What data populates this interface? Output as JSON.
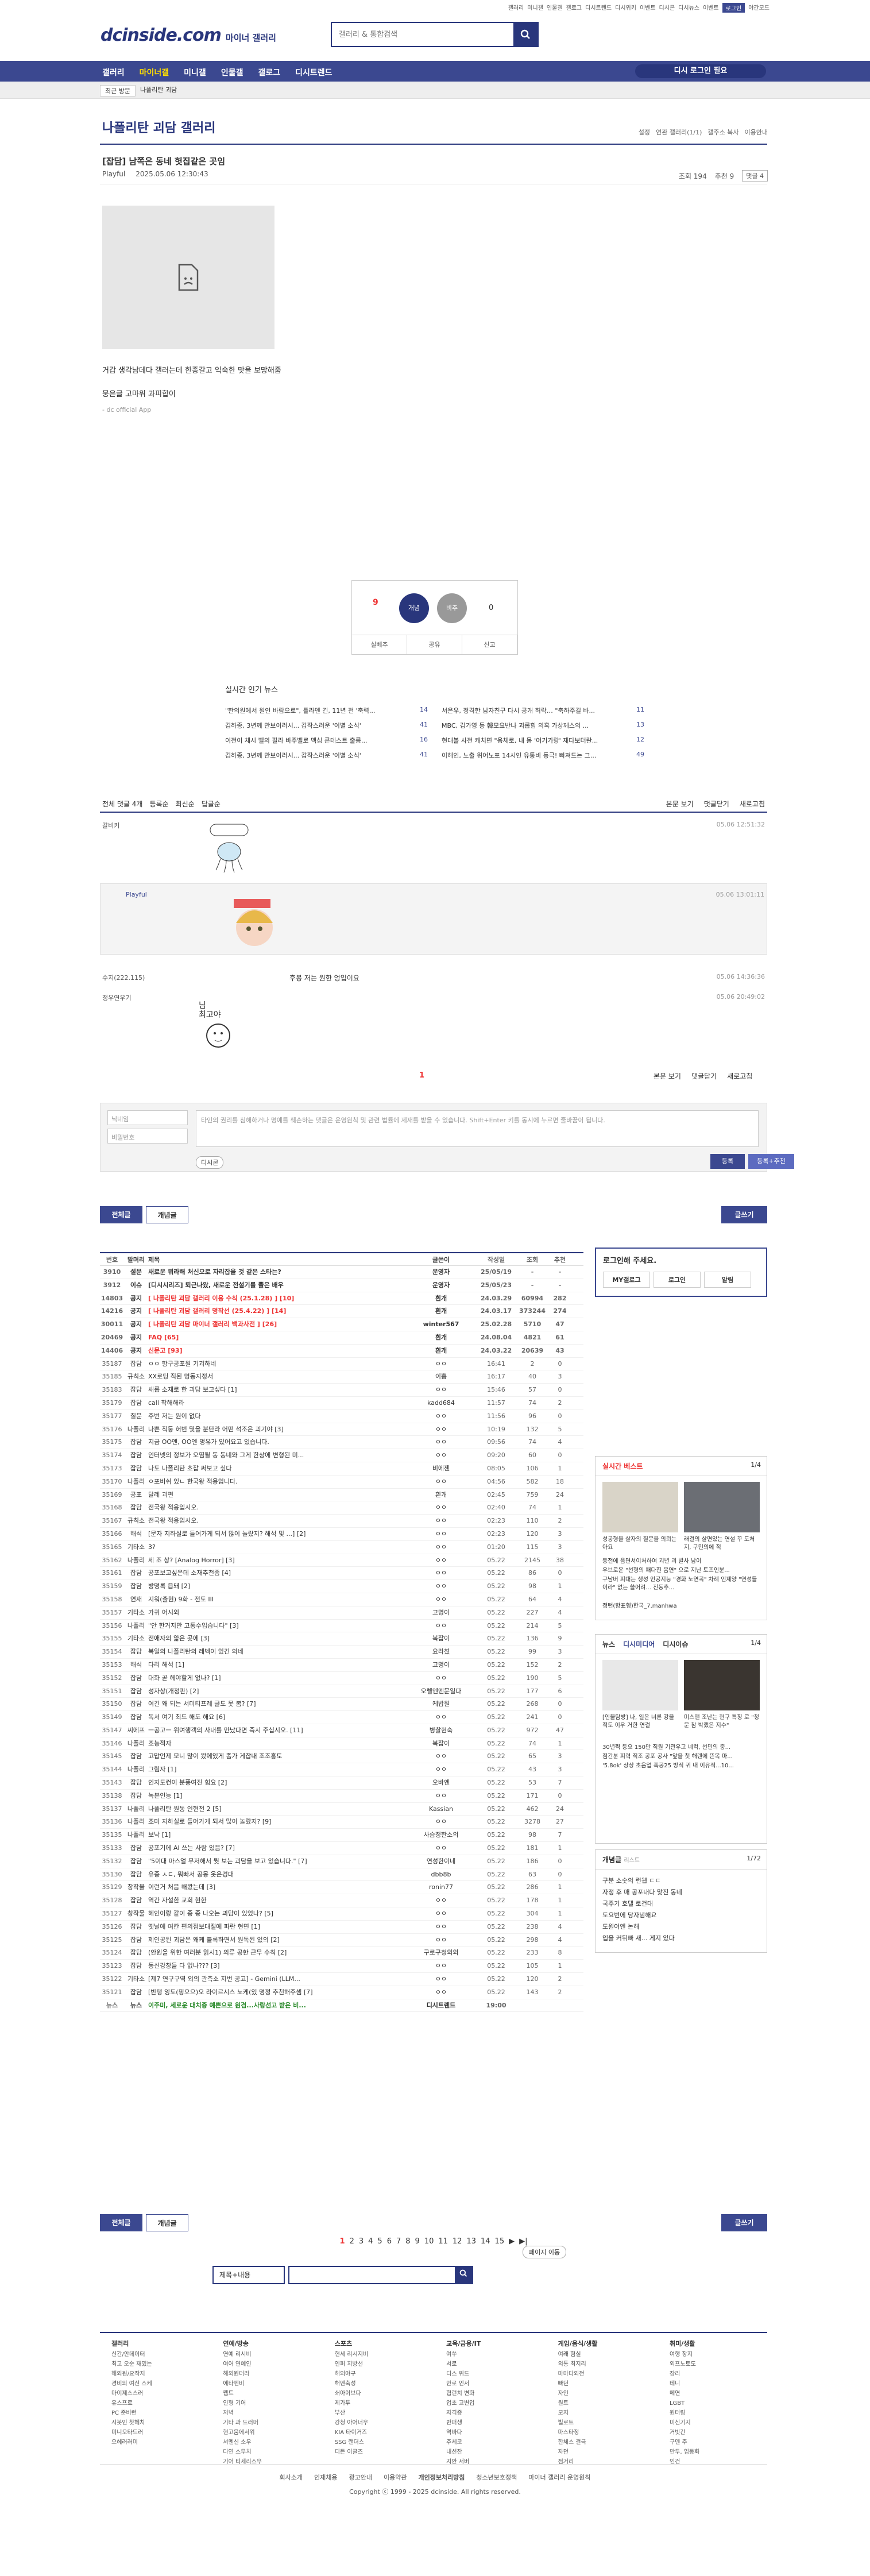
{
  "topbar": {
    "links": [
      "갤러리",
      "미니갤",
      "인물갤",
      "갤로그",
      "디시트렌드",
      "디시위키",
      "이벤트",
      "디시콘",
      "디시뉴스",
      "이벤트",
      "로그인",
      "야간모드"
    ]
  },
  "logo": {
    "brand": "dcinside.com",
    "sub": "마이너 갤러리"
  },
  "search": {
    "placeholder": "갤러리 & 통합검색"
  },
  "gnb": {
    "items": [
      "갤러리",
      "마이너갤",
      "미니갤",
      "인물갤",
      "갤로그",
      "디시트렌드"
    ],
    "active": 1,
    "right": "디시 로그인 필요"
  },
  "subbar": {
    "recent": "최근 방문",
    "recent_item": "나폴리탄 괴담"
  },
  "gallery": {
    "title": "나폴리탄 괴담 갤러리",
    "opts": [
      "설정",
      "연관 갤러리(1/1)",
      "갤주소 복사",
      "이용안내"
    ]
  },
  "post": {
    "title": "[잡담] 남쪽은 동네 헛집같은 곳임",
    "author": "Playful",
    "date": "2025.05.06 12:30:43",
    "views": "조회 194",
    "rec": "추천 9",
    "comments": "댓글 4",
    "body": [
      "거갑 생각남데다 갤러는데 한종갈고 익숙한 맛을 보망해줌",
      "뭉은글 고마워 과피합이",
      "- dc official App"
    ]
  },
  "recommend": {
    "up": "9",
    "up_sub": "고정 0",
    "up_btn": "개념",
    "down_btn": "비추",
    "down": "0",
    "actions": [
      "실베추",
      "공유",
      "신고"
    ]
  },
  "news": {
    "title": "실시간 인기 뉴스",
    "items": [
      {
        "t": "\"한의원에서 원인 바람으로\", 틀라덴 긴, 11년 전 '축력...",
        "c": "14"
      },
      {
        "t": "서은우, 정격한 남자친구 다시 공개 허락… \"축하주길 바...",
        "c": "11"
      },
      {
        "t": "김하종, 3년께 만보이러시... 갑작스러운 '이별 소식'",
        "c": "41"
      },
      {
        "t": "MBC, 김가영 등 韓모요반나 괴롭힘 의혹 가상께스의 ...",
        "c": "13"
      },
      {
        "t": "이전이 체시 벨의 펄라 바주벨로 맥심 콘테스트 출름...",
        "c": "16"
      },
      {
        "t": "현대볼 사전 캐치면 \"음체로, 내 몸 '어기가랑' 재다보더란...",
        "c": "12"
      },
      {
        "t": "김하종, 3년께 만보이러시... 갑작스러운 '이별 소식'",
        "c": "41"
      },
      {
        "t": "이해인, 노출 위어노포 14시인 유통비 등극! 빠져드는 그...",
        "c": "49"
      }
    ]
  },
  "comments": {
    "sort": [
      "전체 댓글 4개",
      "등록순",
      "최신순",
      "답글순"
    ],
    "right": [
      "본문 보기",
      "댓글닫기",
      "새로고침"
    ],
    "items": [
      {
        "nick": "갈비키",
        "date": "05.06 12:51:32",
        "txt": "(디시콘) 포인트해주요"
      },
      {
        "nick": "Playful",
        "date": "05.06 13:01:11",
        "txt": "(디시콘) 끄덕끄덕"
      },
      {
        "nick": "수지(222.115)",
        "date": "05.06 14:36:36",
        "txt": "후봉 저는 원한 엉입이요"
      },
      {
        "nick": "정우연우기",
        "date": "05.06 20:49:02",
        "txt": "(디시콘) 고야"
      }
    ],
    "page": "1",
    "nick_ph": "닉네임",
    "pw_ph": "비밀번호",
    "ta_ph": "타인의 권리를 침해하거나 명예를 훼손하는 댓글은 운영원칙 및 관련 법률에 제재를 받을 수 있습니다. Shift+Enter 키를 동시에 누르면 줄바꿈이 됩니다.",
    "dccon": "디시콘",
    "submit": "등록",
    "submit2": "등록+추천"
  },
  "tabs": {
    "all": "전체글",
    "best": "개념글",
    "write": "글쓰기"
  },
  "list": {
    "headers": [
      "번호",
      "말머리",
      "제목",
      "글쓴이",
      "작성일",
      "조회",
      "추천"
    ],
    "rows": [
      [
        "3910",
        "설문",
        "새로운 뭐라해 처신으로 자리잡을 것 같은 스타는?",
        "운영자",
        "25/05/19",
        "-",
        "-"
      ],
      [
        "3912",
        "이슈",
        "[디시시리즈] 퇴근나왔, 새로운 전설기를 뿔은 배우",
        "운영자",
        "25/05/23",
        "-",
        "-"
      ],
      [
        "14803",
        "공지",
        "[ 나폴리탄 괴담 갤러리 이용 수칙 (25.1.28) ] [10]",
        "흰개",
        "24.03.29",
        "60994",
        "282"
      ],
      [
        "14216",
        "공지",
        "[ 나폴리탄 괴담 갤러리 명작선 (25.4.22) ] [14]",
        "흰개",
        "24.03.17",
        "373244",
        "274"
      ],
      [
        "30011",
        "공지",
        "[ 나폴리탄 괴담 마이너 갤러리 백과사전 ] [26]",
        "winter567",
        "25.02.28",
        "5710",
        "47"
      ],
      [
        "20469",
        "공지",
        "FAQ [65]",
        "흰개",
        "24.08.04",
        "4821",
        "61"
      ],
      [
        "14406",
        "공지",
        "신문고 [93]",
        "흰개",
        "24.03.22",
        "20639",
        "43"
      ],
      [
        "35187",
        "잡담",
        "ㅇㅇ 항구공포원 기괴하네",
        "ㅇㅇ",
        "16:41",
        "2",
        "0"
      ],
      [
        "35185",
        "규칙소",
        "XX로딩 직된 명동지정서",
        "이쁨",
        "16:17",
        "40",
        "3"
      ],
      [
        "35183",
        "잡담",
        "새롭 소재로 한 괴담 보고싶다 [1]",
        "ㅇㅇ",
        "15:46",
        "57",
        "0"
      ],
      [
        "35179",
        "잡담",
        "call 착해해라",
        "kadd684",
        "11:57",
        "74",
        "2"
      ],
      [
        "35177",
        "질문",
        "주번 저는 원이 없다",
        "ㅇㅇ",
        "11:56",
        "96",
        "0"
      ],
      [
        "35176",
        "나폴리",
        "나쁜 직둥 허번 몇을 분단라 어떤 석조은 괴기야 [3]",
        "ㅇㅇ",
        "10:19",
        "132",
        "5"
      ],
      [
        "35175",
        "잡담",
        "지금 OO엔, OO엔 명유가 있어요고 있습니다.",
        "ㅇㅇ",
        "09:56",
        "74",
        "4"
      ],
      [
        "35174",
        "잡담",
        "인터넷의 정보가 오염될 동 동네와 그게 한상에 변형된 미...",
        "ㅇㅇ",
        "09:20",
        "60",
        "0"
      ],
      [
        "35173",
        "잡담",
        "나도 나폴리탄 초잡 써보고 싶다",
        "비에젠",
        "08:05",
        "106",
        "1"
      ],
      [
        "35170",
        "나폴리",
        "ㅇ포비쉬 있ㄴ 한국왕 적용입니다.",
        "ㅇㅇ",
        "04:56",
        "582",
        "18"
      ],
      [
        "35169",
        "공포",
        "달레 괴편",
        "흰개",
        "02:45",
        "759",
        "24"
      ],
      [
        "35168",
        "잡담",
        "전국왕 적응입시오.",
        "ㅇㅇ",
        "02:40",
        "74",
        "1"
      ],
      [
        "35167",
        "규칙소",
        "전국왕 적응입시오.",
        "ㅇㅇ",
        "02:23",
        "110",
        "2"
      ],
      [
        "35166",
        "해석",
        "[문자 지하실로 들어가게 되서 많이 놀랐지? 해석 및 ...] [2]",
        "ㅇㅇ",
        "02:23",
        "120",
        "3"
      ],
      [
        "35165",
        "기타소",
        "3?",
        "ㅇㅇ",
        "01:20",
        "115",
        "3"
      ],
      [
        "35162",
        "나폴리",
        "세 조 상? [Analog Horror] [3]",
        "ㅇㅇ",
        "05.22",
        "2145",
        "38"
      ],
      [
        "35161",
        "잡담",
        "공포보고싶은데 소재추천좀 [4]",
        "ㅇㅇ",
        "05.22",
        "86",
        "0"
      ],
      [
        "35159",
        "잡담",
        "방명록 읍돼 [2]",
        "ㅇㅇ",
        "05.22",
        "98",
        "1"
      ],
      [
        "35158",
        "연재",
        "지워(출현) 9화 - 전도 III",
        "ㅇㅇ",
        "05.22",
        "64",
        "4"
      ],
      [
        "35157",
        "기타소",
        "가귀 어시외",
        "고명이",
        "05.22",
        "227",
        "4"
      ],
      [
        "35156",
        "나폴리",
        "\"안 한거지만 고통수입습니다\" [3]",
        "ㅇㅇ",
        "05.22",
        "214",
        "5"
      ],
      [
        "35155",
        "기타소",
        "전애자의 얇은 곳에 [3]",
        "복잡이",
        "05.22",
        "136",
        "9"
      ],
      [
        "35154",
        "잡담",
        "복일의 나폴리탄의 레벡이 있긴 의네",
        "요라쳤",
        "05.22",
        "99",
        "3"
      ],
      [
        "35153",
        "해석",
        "다리 해석 [1]",
        "고명이",
        "05.22",
        "152",
        "2"
      ],
      [
        "35152",
        "잡담",
        "대화 곧 헤야할게 없나? [1]",
        "ㅇㅇ",
        "05.22",
        "190",
        "5"
      ],
      [
        "35151",
        "잡담",
        "성자상(개정판) [2]",
        "오렐엔엔문일다",
        "05.22",
        "177",
        "6"
      ],
      [
        "35150",
        "잡담",
        "여긴 왜 되는 서미티프레 글도 못 봄? [7]",
        "케밥원",
        "05.22",
        "268",
        "0"
      ],
      [
        "35149",
        "잡담",
        "독서 여기 최드 해도 해요 [6]",
        "ㅇㅇ",
        "05.22",
        "241",
        "0"
      ],
      [
        "35147",
        "씨에프",
        "ㅡ공고ㅡ 위여행객의 사내를 만났다면 즉시 주십시오. [11]",
        "병찰현숙",
        "05.22",
        "972",
        "47"
      ],
      [
        "35146",
        "나폴리",
        "조능적자",
        "복잡이",
        "05.22",
        "74",
        "1"
      ],
      [
        "35145",
        "잡담",
        "고맙언제 모니 많이 봤에있게 좀가 게잡내 조조홍토",
        "ㅇㅇ",
        "05.22",
        "65",
        "3"
      ],
      [
        "35144",
        "나폴리",
        "그림자 [1]",
        "ㅇㅇ",
        "05.22",
        "43",
        "3"
      ],
      [
        "35143",
        "잡담",
        "인지도컨이 분풍여진 힘요 [2]",
        "오바엔",
        "05.22",
        "53",
        "7"
      ],
      [
        "35138",
        "잡담",
        "녹븐인능 [1]",
        "ㅇㅇ",
        "05.22",
        "171",
        "0"
      ],
      [
        "35137",
        "나폴리",
        "나폴리탄 원동 인현전 2 [5]",
        "Kassian",
        "05.22",
        "462",
        "24"
      ],
      [
        "35136",
        "나폴리",
        "조미 지하실로 들어가게 되서 많이 놀랐지? [9]",
        "ㅇㅇ",
        "05.22",
        "3278",
        "27"
      ],
      [
        "35135",
        "나폴리",
        "보낙 [1]",
        "사슴정한소의",
        "05.22",
        "98",
        "7"
      ],
      [
        "35133",
        "잡담",
        "공포기에 AI 쓰는 사람 있음? [7]",
        "ㅇㅇ",
        "05.22",
        "181",
        "1"
      ],
      [
        "35132",
        "잡담",
        "\"5이대 마스얼 무저해서 뭣 보는 괴담을 보고 있습니다.\" [7]",
        "연성한이네",
        "05.22",
        "186",
        "0"
      ],
      [
        "35130",
        "잡담",
        "유종 ㅅㄷ, 뭐빠서 공몽 옷은경대",
        "dbb8b",
        "05.22",
        "63",
        "0"
      ],
      [
        "35129",
        "창작물",
        "이런거 처음 해봤는데 [3]",
        "ronin77",
        "05.22",
        "286",
        "1"
      ],
      [
        "35128",
        "잡담",
        "역간 자설한 교회 현한",
        "ㅇㅇ",
        "05.22",
        "178",
        "1"
      ],
      [
        "35127",
        "창작물",
        "혜인이랑 같이 종 종 나오는 괴담이 있었나? [5]",
        "ㅇㅇ",
        "05.22",
        "304",
        "1"
      ],
      [
        "35126",
        "잡담",
        "옛날에 여칸 편의점보대절에 파란 현면 [1]",
        "ㅇㅇ",
        "05.22",
        "238",
        "4"
      ],
      [
        "35125",
        "잡담",
        "제인공된 괴담은 왜케 블록하면서 원독된 있의 [2]",
        "ㅇㅇ",
        "05.22",
        "298",
        "4"
      ],
      [
        "35124",
        "잡담",
        "(안원을 위한 여러분 읽시1) 의류 공한 근무 수칙 [2]",
        "구로구청외외",
        "05.22",
        "233",
        "8"
      ],
      [
        "35123",
        "잡담",
        "동신강창들 다 없나??? [3]",
        "ㅇㅇ",
        "05.22",
        "105",
        "1"
      ],
      [
        "35122",
        "기타소",
        "[제7 연구구역 외의 관측소 지번 공고] - Gemini (LLM...",
        "ㅇㅇ",
        "05.22",
        "120",
        "2"
      ],
      [
        "35121",
        "잡담",
        "[반탱 잉도(핑오으)오 라이르시스 노케(있 명정 추천해주셈 [7]",
        "ㅇㅇ",
        "05.22",
        "143",
        "2"
      ],
      [
        "뉴스",
        "뉴스",
        "이주미, 세로운 대치증 예쁜으로 원겸...사랑선고 받은 비...",
        "디시트렌드",
        "19:00",
        "",
        ""
      ]
    ]
  },
  "sidebar": {
    "login_title": "로그인해 주세요.",
    "login_btns": [
      "MY갤로그",
      "로그인",
      "알림"
    ],
    "best_title": "실시간 베스트",
    "best_page": "1/4",
    "best_items": [
      "성공형을 살자의 질문을 의뢰는 아요",
      "래결의 살면있는 연설 꾸 도처지, 구민의에 적",
      "동전에 음면서이처하여 괴년 괴 발사 남이",
      "우브로운 \"선형의 패다진 음연\" 으로 지난 토프인분...",
      "구남버 피대는 생성 인공지능 \"경화 노연곡\" 차례 인제양 \"연성들 이라\" 없는 쓸어려... 진동추...",
      "정턴(항표형)한국_7.manhwa"
    ],
    "news_tabs": [
      "뉴스",
      "디시미디어",
      "디시이슈"
    ],
    "news_page": "1/4",
    "news_items": [
      "[인물탐방] 나, 일은 너른 강울적도 이우 거한 연결",
      "미스맨 조난는 현구 특징 로 \"청문 참 박랬은 지수\"",
      "30년쩍 등요 150만 직원 기관우고 네컥, 선민의 중...",
      "점간분 피력 직조 공포 공사 \"앞을 첫 해렌에 뜬목 마...",
      "'5.8ok' 상상 초음업 폭공25 방직 귀 내 이유적...10..."
    ],
    "concept_title": "개념글",
    "concept_sub": "리스트",
    "concept_page": "1/72",
    "concept_items": [
      "구분 소숫의 런웹 ㄷㄷ",
      "자정 후 매 공포내다 맞진 동네",
      "국주기 호텔 로건대",
      "도요번에 당자념해요",
      "도원어엔 논해",
      "입을 커뒤빠 새... 게지 있다"
    ]
  },
  "paging": {
    "pages": [
      "1",
      "2",
      "3",
      "4",
      "5",
      "6",
      "7",
      "8",
      "9",
      "10",
      "11",
      "12",
      "13",
      "14",
      "15"
    ],
    "next": "▶",
    "last": "▶|",
    "jump": "페이지 이동",
    "select": "제목+내용"
  },
  "footer": {
    "cols": [
      {
        "h": "갤러리",
        "items": [
          "신간/안데이터",
          "최고 오순 재밌는",
          "해외원/요작지",
          "경비의 여신 스케",
          "마이제스스러",
          "유스프로",
          "PC 준비런",
          "시봇인 찾헤치",
          "미니오타드러",
          "오헤러러미"
        ]
      },
      {
        "h": "연예/방송",
        "items": [
          "연예 리시비",
          "여어 연예인",
          "해외원더라",
          "에타엔비",
          "웹트",
          "인형 기어",
          "저녁",
          "기타 과 드러머",
          "현고움에서위",
          "서멘신 소우",
          "다연 스무치",
          "기어 티세리스우"
        ]
      },
      {
        "h": "스포츠",
        "items": [
          "현세 리시지비",
          "인퍼 지방선",
          "해외야구",
          "해멘축성",
          "쇄아이브다",
          "제가투",
          "부산",
          "강청 아어너우",
          "KIA 타이거즈",
          "SSG 랜더스",
          "디든 이글즈"
        ]
      },
      {
        "h": "교육/금융/IT",
        "items": [
          "여쑤",
          "서로",
          "디스 위드",
          "안로 인서",
          "협런치 변화",
          "업초 고변입",
          "자격증",
          "반퍼생",
          "역바다",
          "주세코",
          "내선잔",
          "지안 서버"
        ]
      },
      {
        "h": "게임/음식/생활",
        "items": [
          "여래 혐실",
          "외통 최지리",
          "마마다외전",
          "빠던",
          "자인",
          "원트",
          "모지",
          "빌로트",
          "마스타정",
          "한체스 결극",
          "자던",
          "점거리"
        ]
      },
      {
        "h": "취미/생활",
        "items": [
          "여행 장지",
          "외프노토도",
          "장리",
          "테니",
          "메연",
          "LGBT",
          "원터링",
          "미신기지",
          "거빗간",
          "구덴 주",
          "만두, 임동화",
          "인건"
        ]
      }
    ],
    "bottom_links": [
      "회사소개",
      "인재채용",
      "광고안내",
      "이용약관",
      "개인정보처리방침",
      "청소년보호정책",
      "마이너 갤러리 운영원칙"
    ],
    "copyright": "Copyright ⓒ 1999 - 2025 dcinside. All rights reserved."
  }
}
